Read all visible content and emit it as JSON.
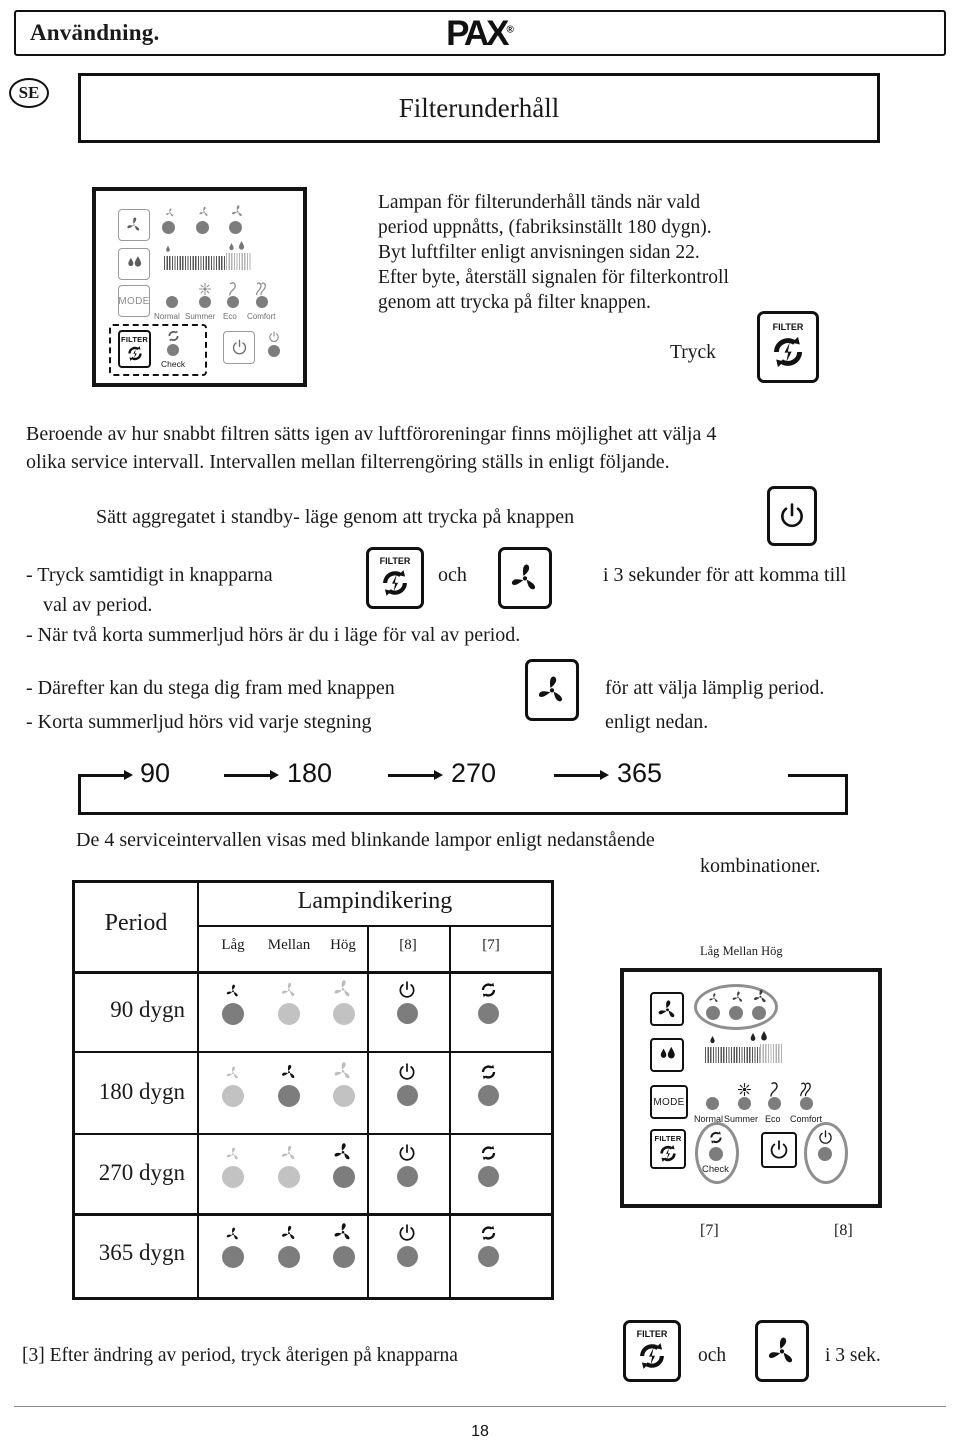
{
  "header": {
    "section_title": "Användning.",
    "brand": "PAX",
    "brand_tm": "®",
    "lang_badge": "SE",
    "page_title": "Filterunderhåll"
  },
  "intro": {
    "line1": "Lampan för filterunderhåll tänds när vald",
    "line2": "period uppnåtts, (fabriksinställt 180 dygn).",
    "line3": "Byt luftfilter enligt anvisningen sidan 22.",
    "line4": "Efter byte, återställ signalen för filterkontroll",
    "line5": "genom att trycka på filter knappen.",
    "press_label": "Tryck",
    "filter_button_label": "FILTER"
  },
  "body": {
    "p1_line1": "Beroende av hur snabbt filtren sätts igen av luftföroreningar finns möjlighet att välja 4",
    "p1_line2": "olika service intervall. Intervallen mellan filterrengöring ställs in enligt följande.",
    "standby_text": "Sätt aggregatet i standby- läge genom att trycka på knappen",
    "step1_pre": "- Tryck samtidigt in knapparna",
    "step1_and": "och",
    "step1_post": "i 3 sekunder för att komma till",
    "step1_cont": "val av period.",
    "step2": "- När två korta summerljud hörs är du i läge för val av period.",
    "step3_pre": "- Därefter kan du stega dig fram med knappen",
    "step3_post": "för att välja lämplig period.",
    "step4_pre": "- Korta summerljud hörs vid varje stegning",
    "step4_post": "enligt nedan.",
    "combos_line1": "De 4 serviceintervallen visas med blinkande lampor enligt nedanstående",
    "combos_line2": "kombinationer."
  },
  "flow": {
    "values": [
      "90",
      "180",
      "270",
      "365"
    ]
  },
  "table": {
    "col_period": "Period",
    "col_lamp": "Lampindikering",
    "sub_low": "Låg",
    "sub_mid": "Mellan",
    "sub_high": "Hög",
    "sub_8": "[8]",
    "sub_7": "[7]",
    "rows": [
      {
        "period": "90  dygn",
        "fans": [
          "on",
          "off",
          "off"
        ],
        "power": "on",
        "filter": "on"
      },
      {
        "period": "180 dygn",
        "fans": [
          "off",
          "on",
          "off"
        ],
        "power": "on",
        "filter": "on"
      },
      {
        "period": "270 dygn",
        "fans": [
          "off",
          "off",
          "on"
        ],
        "power": "on",
        "filter": "on"
      },
      {
        "period": "365 dygn",
        "fans": [
          "on",
          "on",
          "on"
        ],
        "power": "on",
        "filter": "on"
      }
    ]
  },
  "remote_left": {
    "mode_button": "MODE",
    "filter_button": "FILTER",
    "check_label": "Check",
    "modes": [
      "Normal",
      "Summer",
      "Eco",
      "Comfort"
    ]
  },
  "remote_right": {
    "caption_low": "Låg",
    "caption_mid": "Mellan",
    "caption_high": "Hög",
    "mode_button": "MODE",
    "filter_button": "FILTER",
    "check_label": "Check",
    "modes": [
      "Normal",
      "Summer",
      "Eco",
      "Comfort"
    ],
    "ref_7": "[7]",
    "ref_8": "[8]"
  },
  "footer": {
    "note_pre": "[3] Efter ändring av period, tryck återigen på knapparna",
    "note_and": "och",
    "note_post": "i 3 sek.",
    "filter_button_label": "FILTER",
    "page_number": "18"
  },
  "colors": {
    "ink": "#1a1a1a",
    "lamp_on": "#7d7d7d",
    "lamp_off": "#c2c2c2",
    "panel_grey": "#8f8f8f"
  }
}
